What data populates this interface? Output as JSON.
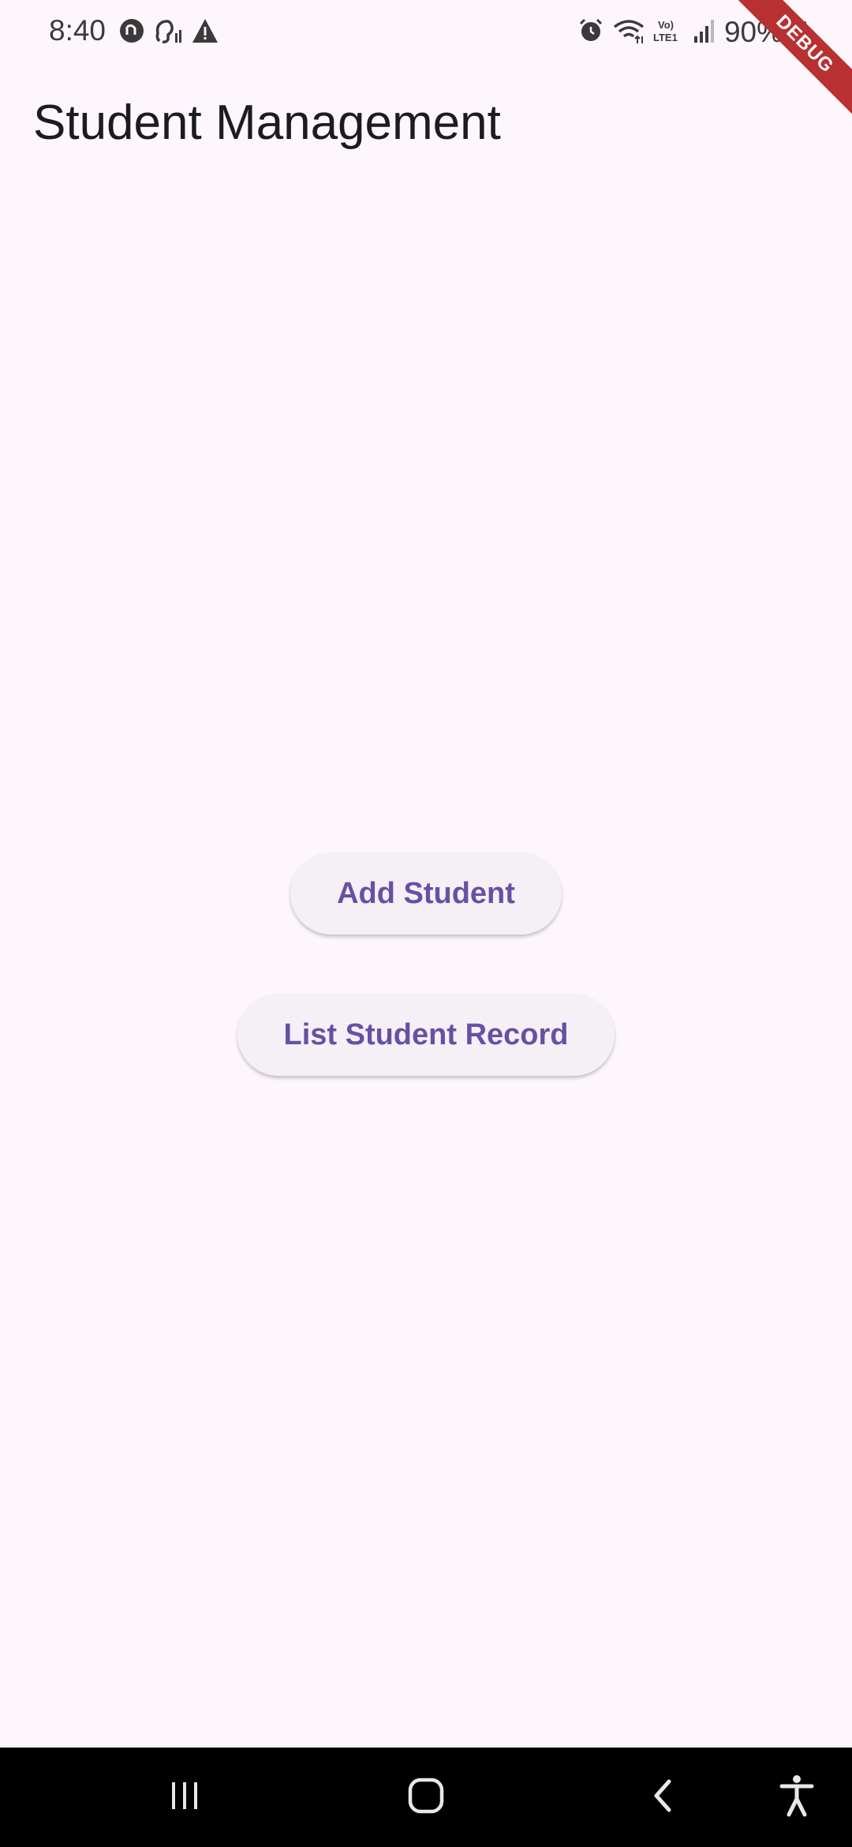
{
  "status_bar": {
    "time": "8:40",
    "battery": "90%",
    "left_icons": [
      "sync-icon",
      "hearing-icon",
      "warning-icon"
    ],
    "right_icons": [
      "alarm-icon",
      "wifi-icon",
      "volte-icon",
      "signal-icon",
      "battery-icon"
    ]
  },
  "debug_banner": "DEBUG",
  "app_bar": {
    "title": "Student Management"
  },
  "actions": {
    "add_student": "Add Student",
    "list_student_record": "List Student Record"
  },
  "nav_bar": {
    "items": [
      "recents-icon",
      "home-icon",
      "back-icon",
      "accessibility-icon"
    ]
  },
  "colors": {
    "background": "#fdf7fd",
    "accent": "#6750a4",
    "button_surface": "#f5f0f6"
  }
}
